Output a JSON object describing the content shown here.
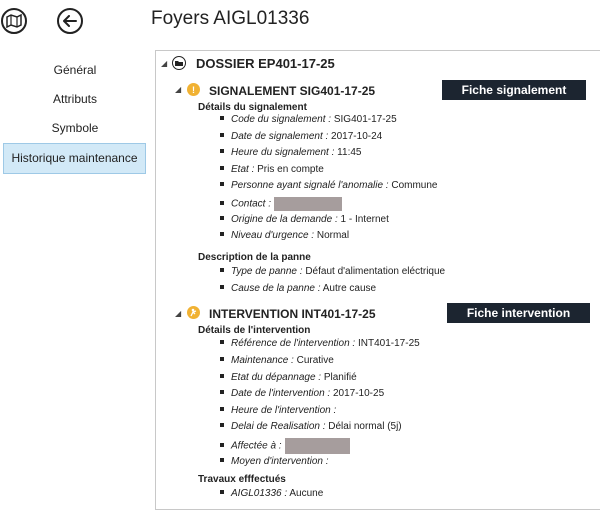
{
  "header": {
    "title": "Foyers AIGL01336"
  },
  "nav": {
    "items": [
      {
        "label": "Général"
      },
      {
        "label": "Attributs"
      },
      {
        "label": "Symbole"
      },
      {
        "label": "Historique maintenance"
      }
    ],
    "active": "Historique maintenance"
  },
  "dossier": {
    "title": "DOSSIER EP401-17-25"
  },
  "signalement": {
    "title": "SIGNALEMENT SIG401-17-25",
    "button": "Fiche signalement",
    "details_title": "Détails du signalement",
    "details": [
      {
        "label": "Code du signalement :",
        "value": " SIG401-17-25"
      },
      {
        "label": "Date de signalement :",
        "value": " 2017-10-24"
      },
      {
        "label": "Heure du signalement :",
        "value": " 11:45"
      },
      {
        "label": "Etat :",
        "value": " Pris en compte"
      },
      {
        "label": "Personne ayant signalé l'anomalie :",
        "value": " Commune"
      },
      {
        "label": "Contact :",
        "value": ""
      },
      {
        "label": "Origine de la demande :",
        "value": " 1 - Internet"
      },
      {
        "label": "Niveau d'urgence :",
        "value": " Normal"
      }
    ],
    "description_title": "Description de la panne",
    "description": [
      {
        "label": "Type de panne :",
        "value": " Défaut d'alimentation eléctrique"
      },
      {
        "label": "Cause de la panne :",
        "value": " Autre cause"
      }
    ]
  },
  "intervention": {
    "title": "INTERVENTION INT401-17-25",
    "button": "Fiche intervention",
    "details_title": "Détails de l'intervention",
    "details": [
      {
        "label": "Référence de l'intervention :",
        "value": " INT401-17-25"
      },
      {
        "label": "Maintenance :",
        "value": " Curative"
      },
      {
        "label": "Etat du dépannage :",
        "value": " Planifié"
      },
      {
        "label": "Date de l'intervention :",
        "value": " 2017-10-25"
      },
      {
        "label": "Heure de l'intervention :",
        "value": ""
      },
      {
        "label": "Delai de Realisation :",
        "value": " Délai normal (5j)"
      },
      {
        "label": "Affectée à :",
        "value": ""
      },
      {
        "label": "Moyen d'intervention :",
        "value": ""
      }
    ],
    "travaux_title": "Travaux efffectués",
    "travaux": [
      {
        "label": "AIGL01336 :",
        "value": " Aucune"
      }
    ]
  }
}
